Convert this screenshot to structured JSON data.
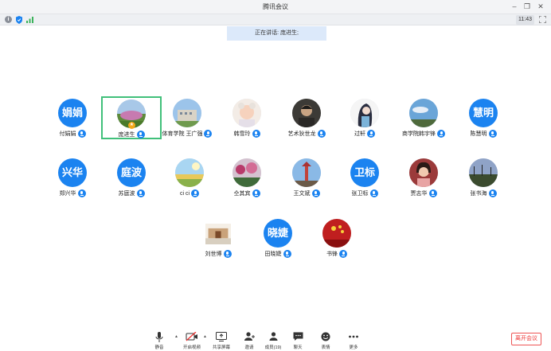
{
  "window": {
    "title": "腾讯会议"
  },
  "status": {
    "time": "11:43"
  },
  "banner": {
    "speaking_label": "正在讲话: 庞进生;"
  },
  "participants": [
    {
      "name": "付娟娟",
      "avatar_text": "娟娟",
      "avatar": "text"
    },
    {
      "name": "庞进生",
      "avatar": "photo-landscape",
      "active": true
    },
    {
      "name": "体育学院 王广强",
      "avatar": "photo-building"
    },
    {
      "name": "韩雪玲",
      "avatar": "photo-baby"
    },
    {
      "name": "艺术狄世龙",
      "avatar": "photo-man"
    },
    {
      "name": "过轩",
      "avatar": "photo-drawing"
    },
    {
      "name": "商学院韩宇锋",
      "avatar": "photo-sky"
    },
    {
      "name": "陈慧明",
      "avatar_text": "慧明",
      "avatar": "text"
    },
    {
      "name": "郑兴华",
      "avatar_text": "兴华",
      "avatar": "text"
    },
    {
      "name": "苏庭波",
      "avatar_text": "庭波",
      "avatar": "text"
    },
    {
      "name": "ci ci",
      "avatar": "photo-field"
    },
    {
      "name": "仝其宾",
      "avatar": "photo-flowers"
    },
    {
      "name": "王文斌",
      "avatar": "photo-tower"
    },
    {
      "name": "张卫标",
      "avatar_text": "卫标",
      "avatar": "text"
    },
    {
      "name": "贾志华",
      "avatar": "photo-girl"
    },
    {
      "name": "张书海",
      "avatar": "photo-dusk"
    },
    {
      "name": "刘世博",
      "avatar": "photo-gate"
    },
    {
      "name": "田晓婕",
      "avatar_text": "晓婕",
      "avatar": "text"
    },
    {
      "name": "书锋",
      "avatar": "photo-red"
    }
  ],
  "toolbar": {
    "mute": "静音",
    "video": "开启视频",
    "share": "共享屏幕",
    "invite": "邀请",
    "members": "成员(19)",
    "chat": "聊天",
    "reactions": "表情",
    "more": "更多",
    "leave": "离开会议"
  },
  "colors": {
    "accent": "#1b83f0",
    "active_border": "#40c07a",
    "leave": "#e33333"
  }
}
